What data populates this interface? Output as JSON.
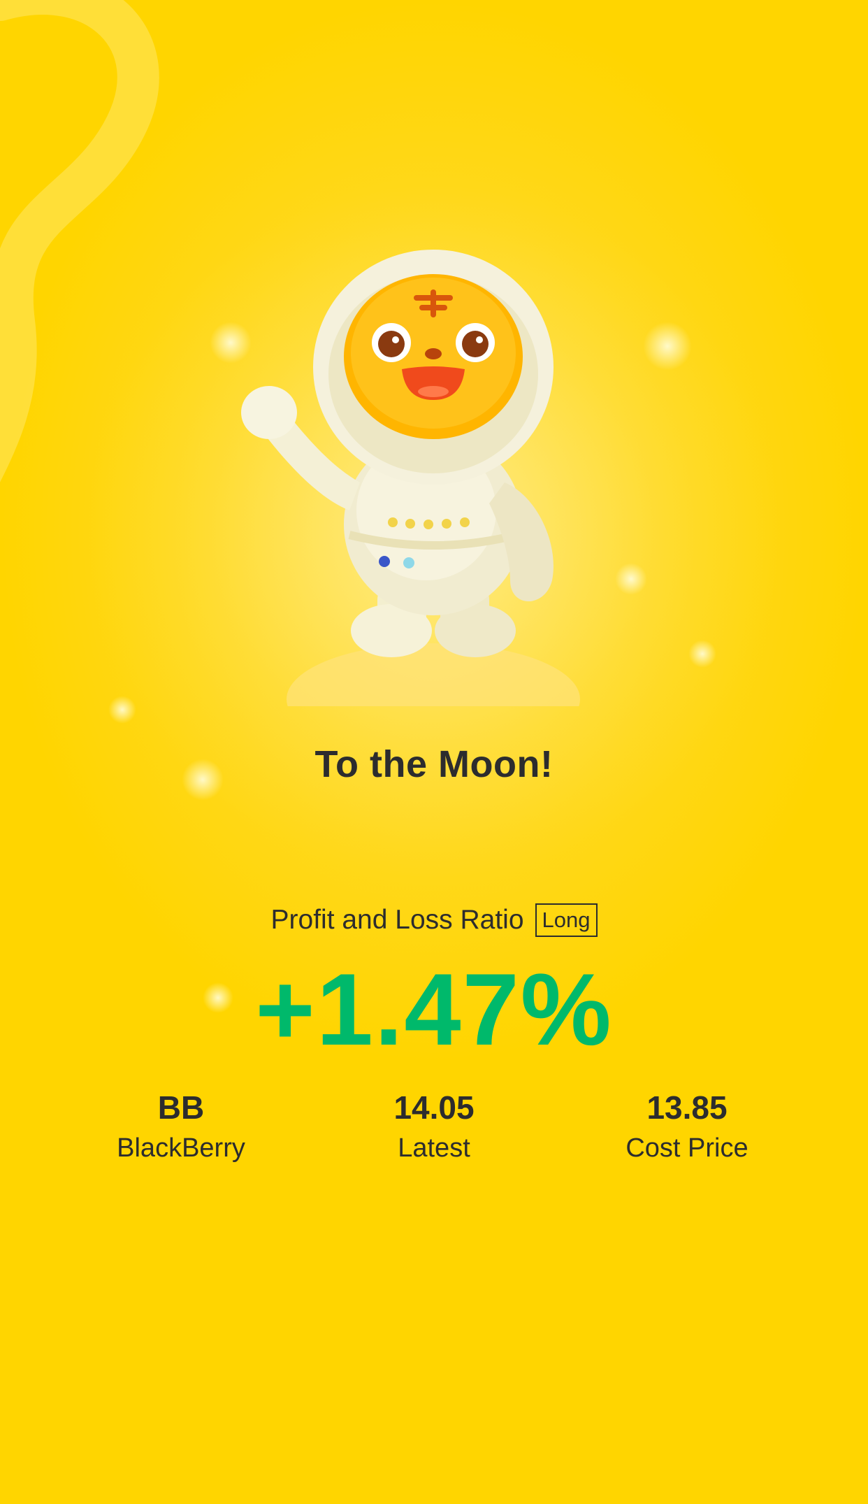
{
  "colors": {
    "background": "#ffd500",
    "text": "#2c2c2e",
    "gain": "#00b96b"
  },
  "hero": {
    "illustration": "tiger-astronaut-mascot",
    "title": "To the Moon!"
  },
  "pnl": {
    "label": "Profit and Loss Ratio",
    "badge": "Long",
    "value": "+1.47%"
  },
  "stats": [
    {
      "value": "BB",
      "label": "BlackBerry"
    },
    {
      "value": "14.05",
      "label": "Latest"
    },
    {
      "value": "13.85",
      "label": "Cost Price"
    }
  ]
}
